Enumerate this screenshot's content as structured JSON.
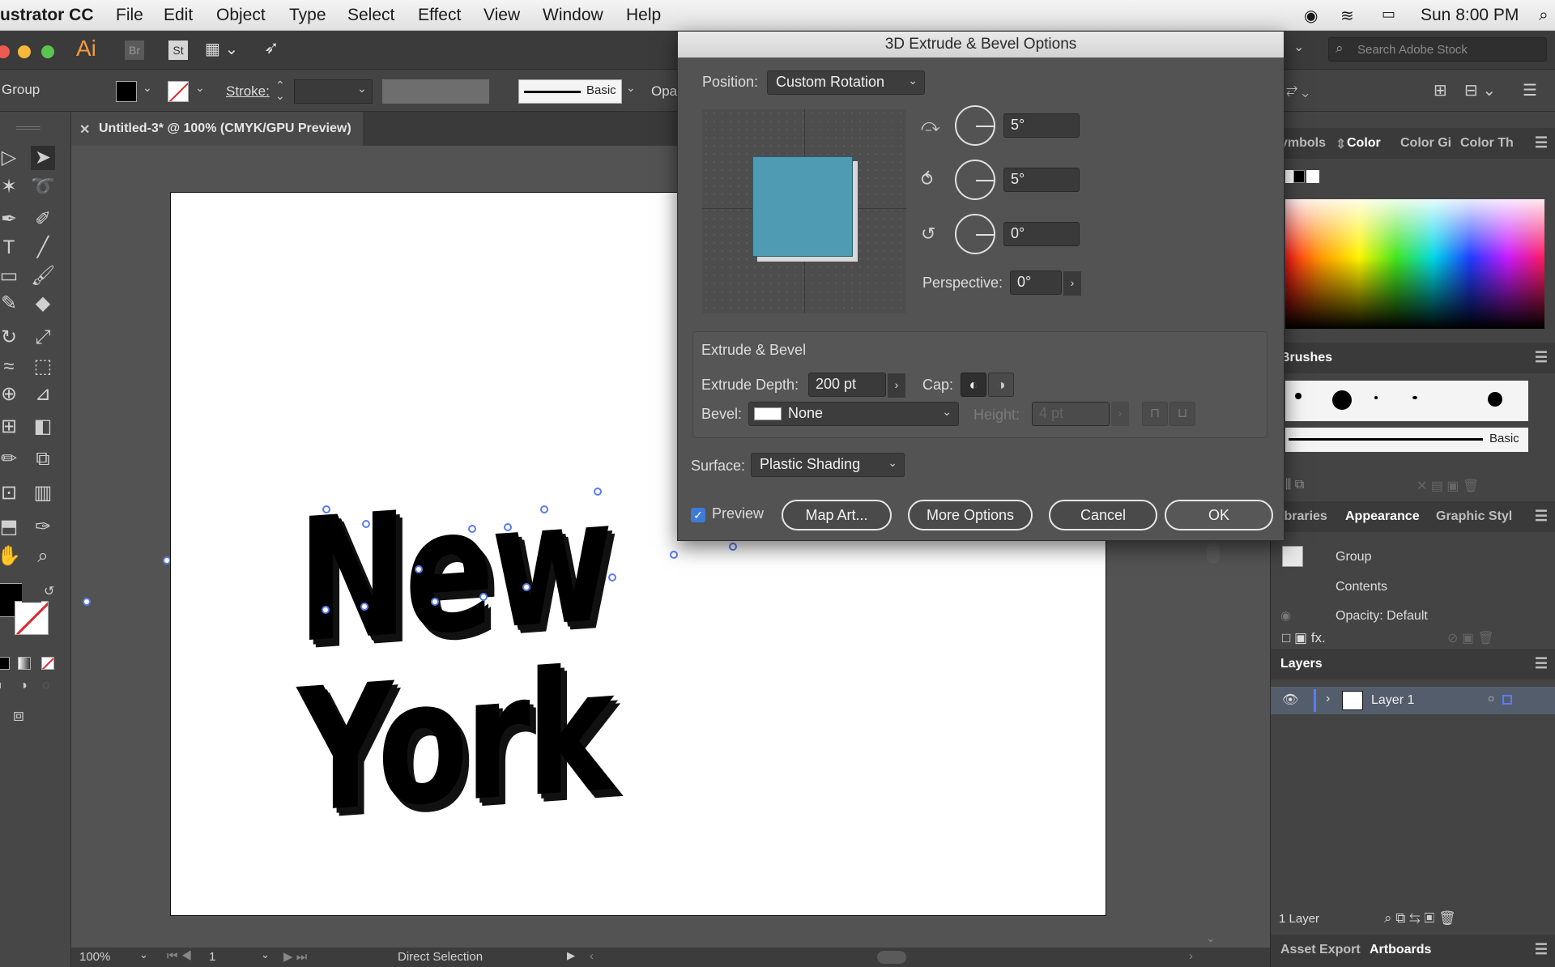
{
  "menubar": {
    "app_name": "ustrator CC",
    "items": [
      "File",
      "Edit",
      "Object",
      "Type",
      "Select",
      "Effect",
      "View",
      "Window",
      "Help"
    ],
    "clock": "Sun 8:00 PM"
  },
  "appbar": {
    "ai_logo": "Ai",
    "br": "Br",
    "st": "St",
    "search_placeholder": "Search Adobe Stock"
  },
  "controlbar": {
    "selection_label": "Group",
    "stroke_label": "Stroke:",
    "brush_label": "Basic",
    "opacity_label": "Opac"
  },
  "document": {
    "tab_title": "Untitled-3* @ 100% (CMYK/GPU Preview)",
    "artwork_text": "New York"
  },
  "statusbar": {
    "zoom": "100%",
    "artboard_number": "1",
    "tool_name": "Direct Selection"
  },
  "dialog": {
    "title": "3D Extrude & Bevel Options",
    "position_label": "Position:",
    "position_value": "Custom Rotation",
    "rotation_x": "5°",
    "rotation_y": "5°",
    "rotation_z": "0°",
    "perspective_label": "Perspective:",
    "perspective_value": "0°",
    "extrude_bevel_header": "Extrude & Bevel",
    "extrude_depth_label": "Extrude Depth:",
    "extrude_depth_value": "200 pt",
    "cap_label": "Cap:",
    "bevel_label": "Bevel:",
    "bevel_value": "None",
    "height_label": "Height:",
    "height_value": "4 pt",
    "surface_label": "Surface:",
    "surface_value": "Plastic Shading",
    "preview_label": "Preview",
    "preview_checked": true,
    "map_art_label": "Map Art...",
    "more_options_label": "More Options",
    "cancel_label": "Cancel",
    "ok_label": "OK",
    "cube_color": "#4f9bb3"
  },
  "right_panel": {
    "color_tabs": [
      "ymbols",
      "Color",
      "Color Gi",
      "Color Th"
    ],
    "brushes_title": "Brushes",
    "brush_line_label": "Basic",
    "appearance_tabs": [
      "ibraries",
      "Appearance",
      "Graphic Styl"
    ],
    "appearance_rows": [
      "Group",
      "Contents",
      "Opacity: Default"
    ],
    "layers_title": "Layers",
    "layer_name": "Layer 1",
    "layers_count": "1 Layer",
    "bottom_tabs": [
      "Asset Export",
      "Artboards"
    ]
  }
}
